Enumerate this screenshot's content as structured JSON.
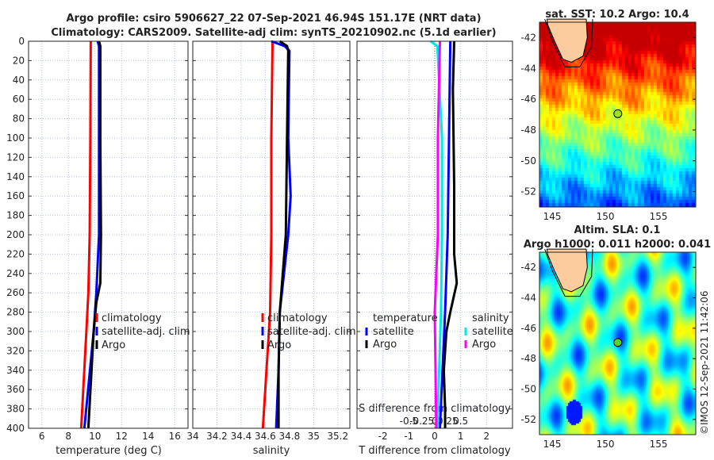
{
  "title_line1": "Argo profile: csiro 5906627_22 07-Sep-2021 46.94S 151.17E (NRT data)",
  "title_line2": "Climatology: CARS2009. Satellite-adj clim: synTS_20210902.nc (5.1d earlier)",
  "credit": "©IMOS 12-Sep-2021 11:42:06",
  "chart_data": [
    {
      "type": "line",
      "xlabel": "temperature (deg C)",
      "xlim": [
        5,
        17
      ],
      "xticks": [
        6,
        8,
        10,
        12,
        14,
        16
      ],
      "ylim": [
        400,
        0
      ],
      "yticks": [
        0,
        20,
        40,
        60,
        80,
        100,
        120,
        140,
        160,
        180,
        200,
        220,
        240,
        260,
        280,
        300,
        320,
        340,
        360,
        380,
        400
      ],
      "grid": true,
      "legend": "lower-right",
      "series": [
        {
          "name": "climatology",
          "color": "#ff0000",
          "depth": [
            0,
            100,
            200,
            260,
            300,
            400
          ],
          "values": [
            9.68,
            9.65,
            9.6,
            9.5,
            9.35,
            8.96
          ]
        },
        {
          "name": "satellite-adj. clim",
          "color": "#0000ff",
          "depth": [
            0,
            5,
            100,
            200,
            260,
            300,
            400
          ],
          "values": [
            10.2,
            10.3,
            10.3,
            10.3,
            10.1,
            9.9,
            9.2
          ]
        },
        {
          "name": "Argo",
          "color": "#000000",
          "depth": [
            0,
            5,
            100,
            200,
            250,
            270,
            300,
            350,
            400
          ],
          "values": [
            10.3,
            10.4,
            10.4,
            10.45,
            10.4,
            10.1,
            9.9,
            9.7,
            9.5
          ]
        }
      ]
    },
    {
      "type": "line",
      "xlabel": "salinity",
      "xlim": [
        34,
        35.3
      ],
      "xticks": [
        34,
        34.2,
        34.4,
        34.6,
        34.8,
        35,
        35.2
      ],
      "ylim": [
        400,
        0
      ],
      "grid": true,
      "legend": "lower-right",
      "series": [
        {
          "name": "climatology",
          "color": "#ff0000",
          "depth": [
            0,
            100,
            200,
            280,
            400
          ],
          "values": [
            34.66,
            34.65,
            34.65,
            34.64,
            34.58
          ]
        },
        {
          "name": "satellite-adj. clim",
          "color": "#0000ff",
          "depth": [
            0,
            5,
            10,
            100,
            160,
            200,
            280,
            340,
            400
          ],
          "values": [
            34.65,
            34.76,
            34.8,
            34.79,
            34.81,
            34.79,
            34.72,
            34.71,
            34.69
          ]
        },
        {
          "name": "Argo",
          "color": "#000000",
          "depth": [
            0,
            5,
            10,
            100,
            200,
            280,
            340,
            400
          ],
          "values": [
            34.72,
            34.78,
            34.79,
            34.78,
            34.77,
            34.72,
            34.71,
            34.71
          ]
        }
      ]
    },
    {
      "type": "line",
      "xlabel": "T difference from climatology",
      "xlim": [
        -3,
        3
      ],
      "xticks": [
        -2,
        -1,
        0,
        1,
        2
      ],
      "x2label": "S difference from climatology",
      "x2lim": [
        -1.5,
        1.5
      ],
      "x2ticks": [
        -0.5,
        -0.25,
        0,
        0.25,
        0.5
      ],
      "ylim": [
        400,
        0
      ],
      "grid": true,
      "legend_titles": [
        "temperature",
        "salinity"
      ],
      "series": [
        {
          "name": "satellite",
          "group": "temperature",
          "color": "#0000ff",
          "axis": "T",
          "depth": [
            0,
            100,
            200,
            280,
            400
          ],
          "values": [
            0.6,
            0.55,
            0.5,
            0.4,
            0.2
          ]
        },
        {
          "name": "Argo",
          "group": "temperature",
          "color": "#000000",
          "axis": "T",
          "depth": [
            0,
            50,
            150,
            220,
            250,
            280,
            300,
            340,
            380,
            400
          ],
          "values": [
            0.75,
            0.7,
            0.75,
            0.75,
            0.85,
            0.6,
            0.45,
            0.35,
            0.4,
            0.4
          ]
        },
        {
          "name": "satellite",
          "group": "salinity",
          "color": "#00e8e8",
          "axis": "S",
          "depth": [
            0,
            5,
            100,
            200,
            280,
            400
          ],
          "values": [
            -0.08,
            0.05,
            0.14,
            0.14,
            0.12,
            0.05
          ]
        },
        {
          "name": "Argo",
          "group": "salinity",
          "color": "#ff00ff",
          "axis": "S",
          "depth": [
            0,
            100,
            200,
            280,
            400
          ],
          "values": [
            0.1,
            0.06,
            0.06,
            0.0,
            0.03
          ]
        }
      ]
    },
    {
      "type": "heatmap",
      "title": "sat. SST: 10.2 Argo: 10.4",
      "xlim": [
        143.8,
        158.5
      ],
      "xticks": [
        145,
        150,
        155
      ],
      "ylim": [
        -53,
        -41
      ],
      "yticks": [
        -42,
        -44,
        -46,
        -48,
        -50,
        -52
      ],
      "marker": {
        "lon": 151.17,
        "lat": -46.94
      }
    },
    {
      "type": "heatmap",
      "title": "Altim. SLA: 0.1",
      "subtitle": "Argo h1000: 0.011 h2000: 0.041",
      "xlim": [
        143.8,
        158.5
      ],
      "xticks": [
        145,
        150,
        155
      ],
      "ylim": [
        -53,
        -41
      ],
      "yticks": [
        -42,
        -44,
        -46,
        -48,
        -50,
        -52
      ],
      "marker": {
        "lon": 151.17,
        "lat": -46.94
      }
    }
  ]
}
